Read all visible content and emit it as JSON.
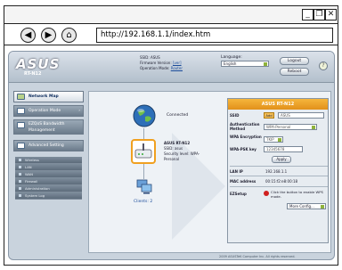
{
  "browser": {
    "url": "http://192.168.1.1/index.htm",
    "controls": {
      "minimize": "_",
      "maximize": "❐",
      "close": "✕"
    },
    "nav": {
      "back": "◀",
      "forward": "▶",
      "home": "⌂"
    }
  },
  "router": {
    "brand": "ASUS",
    "model": "RT-N12",
    "header_info": {
      "ssid_label": "SSID: ASUS",
      "firmware_label": "Firmware Version:",
      "firmware_link": "[ver]",
      "mode_label": "Operation Mode:",
      "mode_link": "Router"
    },
    "language": {
      "label": "Language:",
      "value": "English"
    },
    "buttons": {
      "logout": "Logout",
      "reboot": "Reboot",
      "help": "?"
    }
  },
  "sidebar": {
    "items": [
      {
        "label": "Network Map"
      },
      {
        "label": "Operation Mode"
      },
      {
        "label": "EZQoS Bandwidth Management"
      },
      {
        "label": "Advanced Setting"
      }
    ],
    "submenu": [
      {
        "label": "Wireless"
      },
      {
        "label": "LAN"
      },
      {
        "label": "WAN"
      },
      {
        "label": "Firewall"
      },
      {
        "label": "Administration"
      },
      {
        "label": "System Log"
      }
    ]
  },
  "map": {
    "internet_status": "Connected",
    "router_info": {
      "line1": "ASUS RT-N12",
      "line2": "SSID: asus",
      "line3": "Security level: WPA-",
      "line4": "Personal"
    },
    "clients_label": "Clients: 2"
  },
  "status_panel": {
    "title": "ASUS RT-N12",
    "ssid_label": "SSID",
    "ssid_button": "Add",
    "ssid_value": "ASUS",
    "auth_label": "Authentication Method",
    "auth_value": "WPA-Personal",
    "wpa_enc_label": "WPA Encryption",
    "wpa_enc_value": "TKIP",
    "wpa_key_label": "WPA-PSK key",
    "wpa_key_value": "12345678",
    "apply_label": "Apply",
    "lan_ip_label": "LAN IP",
    "lan_ip_value": "192.168.1.1",
    "mac_label": "MAC address",
    "mac_value": "00:15:f2:e8:00:18",
    "ezsetup_label": "EZSetup",
    "ezsetup_text": "Click the button to enable WPS mode.",
    "more_config": "More Config..."
  },
  "footer": "2009 ASUSTeK Computer Inc. All rights reserved."
}
